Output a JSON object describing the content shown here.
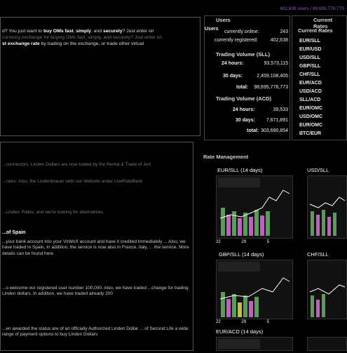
{
  "header": {
    "stats_text": "402,638 users / 98,695,776,773"
  },
  "intro": {
    "line1_pre": "d? You just want to ",
    "line1_b1": "buy OMs fast",
    "line1_mid": ", ",
    "line1_b2": "simply",
    "line1_mid2": ", and ",
    "line1_b3": "securely",
    "line1_post": "? Just enter on",
    "line2": "currency exchange for buying OMs fast, simply, and securely? Just enter on",
    "line3_pre": "st exchange rate",
    "line3_post": " by trading on the exchange, or trade other virtual"
  },
  "users": {
    "title": "Users",
    "heading": "Users",
    "online_label": "currently online:",
    "online_value": "243",
    "registered_label": "currently registered:",
    "registered_value": "402,638",
    "sll_title": "Trading Volume (SLL)",
    "sll_24h_label": "24 hours:",
    "sll_24h_value": "93,573,115",
    "sll_30d_label": "30 days:",
    "sll_30d_value": "2,459,108,405",
    "sll_total_label": "total:",
    "sll_total_value": "98,695,776,773",
    "acd_title": "Trading Volume (ACD)",
    "acd_24h_label": "24 hours:",
    "acd_24h_value": "39,533",
    "acd_30d_label": "30 days:",
    "acd_30d_value": "7,671,891",
    "acd_total_label": "total:",
    "acd_total_value": "303,690,854"
  },
  "rates": {
    "title": "Current Rates",
    "items": [
      "EUR/SLL",
      "EUR/USD",
      "USD/SLL",
      "GBP/SLL",
      "CHF/SLL",
      "EUR/ACD",
      "USD/ACD",
      "SLL/ACD",
      "EUR/OMC",
      "USD/OMC",
      "EUR/OMC",
      "BTC/EUR"
    ]
  },
  "rate_mgmt": {
    "title": "Rate Management",
    "charts": [
      {
        "label": "EUR/SLL (14 days)",
        "x_labels": [
          "22",
          "29",
          "5"
        ]
      },
      {
        "label": "USD/SLL",
        "x_labels": [
          "22",
          "29"
        ]
      },
      {
        "label": "GBP/SLL (14 days)",
        "x_labels": [
          "22",
          "29",
          "5"
        ]
      },
      {
        "label": "CHF/SLL",
        "x_labels": [
          "22",
          "29"
        ]
      },
      {
        "label": "EUR/ACD (14 days)",
        "x_labels": []
      }
    ]
  },
  "news": [
    {
      "text": "...connectors. Linden Dollars are now traded by the Rental & Trade of JeX"
    },
    {
      "text": "...rates. Also, the Lindenbrauer sells our Website under LiveRateBank"
    },
    {
      "text": "...Lindex. Rates, and we're looking for alternatives."
    },
    {
      "head": "...of Spain",
      "text": "...your bank account into your VirWoX account and have it credited immediately ... Also, we have traded in Spain, In addition, the service is now also in France, Italy, ... the service. More details can be found here."
    },
    {
      "text": "...o welcome our registered user number 100,000. Also, we have traded ...change for trading Linden dollars. In addition, we have traded already 200"
    },
    {
      "text": "...en awarded the status are of an officially Authorized Linden Dollar ... of Second Life a wide range of payment options to buy Linden Dollars"
    }
  ],
  "colors": {
    "accent": "#8a5ac8",
    "background": "#000000",
    "panel_border": "#555555"
  }
}
